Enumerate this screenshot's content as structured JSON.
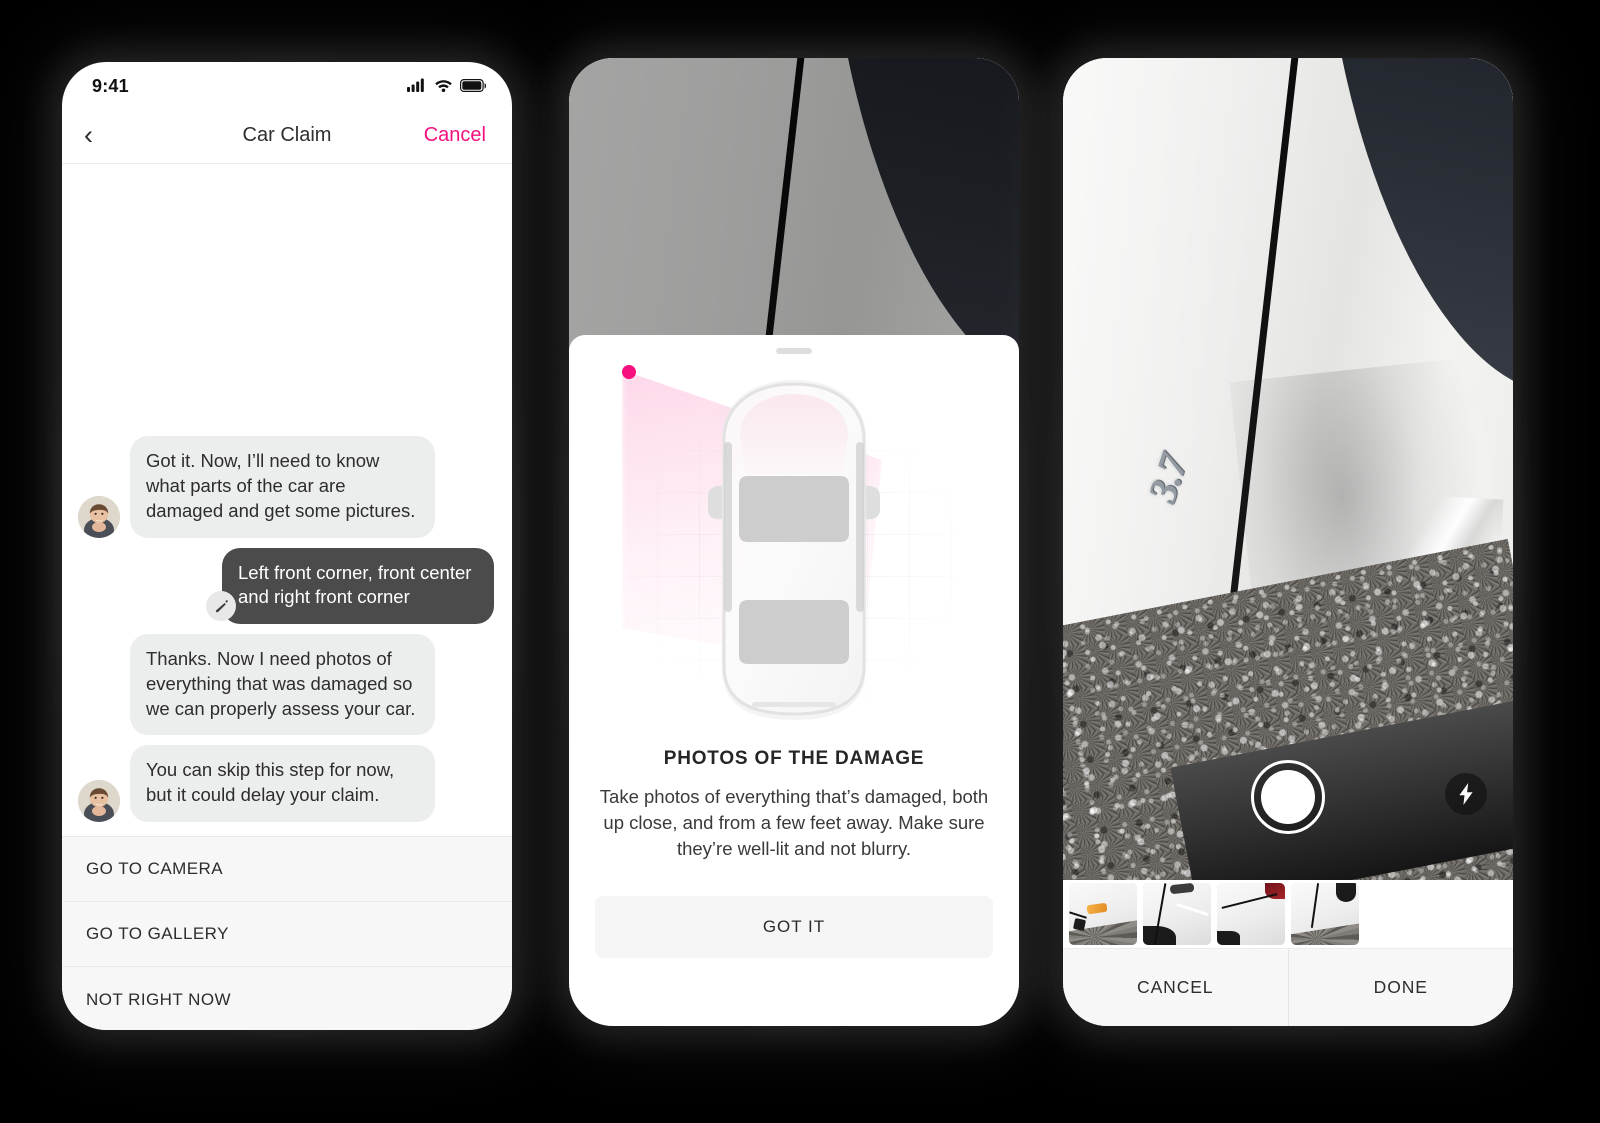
{
  "brand": {
    "accent": "#F5107E",
    "bubble_in_bg": "#ECEDED",
    "bubble_out_bg": "#4B4B4B"
  },
  "phone1": {
    "status": {
      "time": "9:41",
      "signal_icon": "cellular-signal-icon",
      "wifi_icon": "wifi-icon",
      "battery_icon": "battery-icon"
    },
    "navbar": {
      "back_icon": "chevron-left-icon",
      "title": "Car Claim",
      "cancel_label": "Cancel"
    },
    "messages": [
      {
        "from": "agent",
        "avatar": "agent-avatar",
        "text": "Got it. Now, I’ll need to know what parts of the car are damaged and get some pictures."
      },
      {
        "from": "user",
        "edit_icon": "pencil-icon",
        "text": "Left front corner, front center and right front corner"
      },
      {
        "from": "agent",
        "avatar": null,
        "text": "Thanks. Now I need photos of everything that was damaged so we can properly assess your car."
      },
      {
        "from": "agent",
        "avatar": "agent-avatar",
        "text": "You can skip this step for now, but it could delay your claim."
      }
    ],
    "actions": [
      {
        "label": "GO TO CAMERA"
      },
      {
        "label": "GO TO GALLERY"
      },
      {
        "label": "NOT RIGHT NOW"
      }
    ]
  },
  "phone2": {
    "camera_preview": "dimmed-camera-preview-of-white-car-damage",
    "sheet": {
      "grabber": "sheet-grabber",
      "illustration": {
        "name": "top-down-car-diagram",
        "highlight_point": "left-front-corner-marker",
        "highlight_color": "#F5107E"
      },
      "title": "PHOTOS OF THE DAMAGE",
      "body": "Take photos of everything that’s damaged, both up close, and from a few feet away. Make sure they’re well-lit and not blurry.",
      "primary_button": "GOT IT"
    }
  },
  "phone3": {
    "camera_preview": "live-camera-preview-white-car-dented-door",
    "badge_text": "3.7",
    "shutter": "shutter-button",
    "flash_icon": "flash-bolt-icon",
    "thumbnails": [
      {
        "name": "thumbnail-front-bumper-headlight-damage"
      },
      {
        "name": "thumbnail-creased-hood-panel"
      },
      {
        "name": "thumbnail-rear-quarter-scrape"
      },
      {
        "name": "thumbnail-side-panel-dent"
      }
    ],
    "buttons": {
      "cancel_label": "CANCEL",
      "done_label": "DONE"
    }
  }
}
